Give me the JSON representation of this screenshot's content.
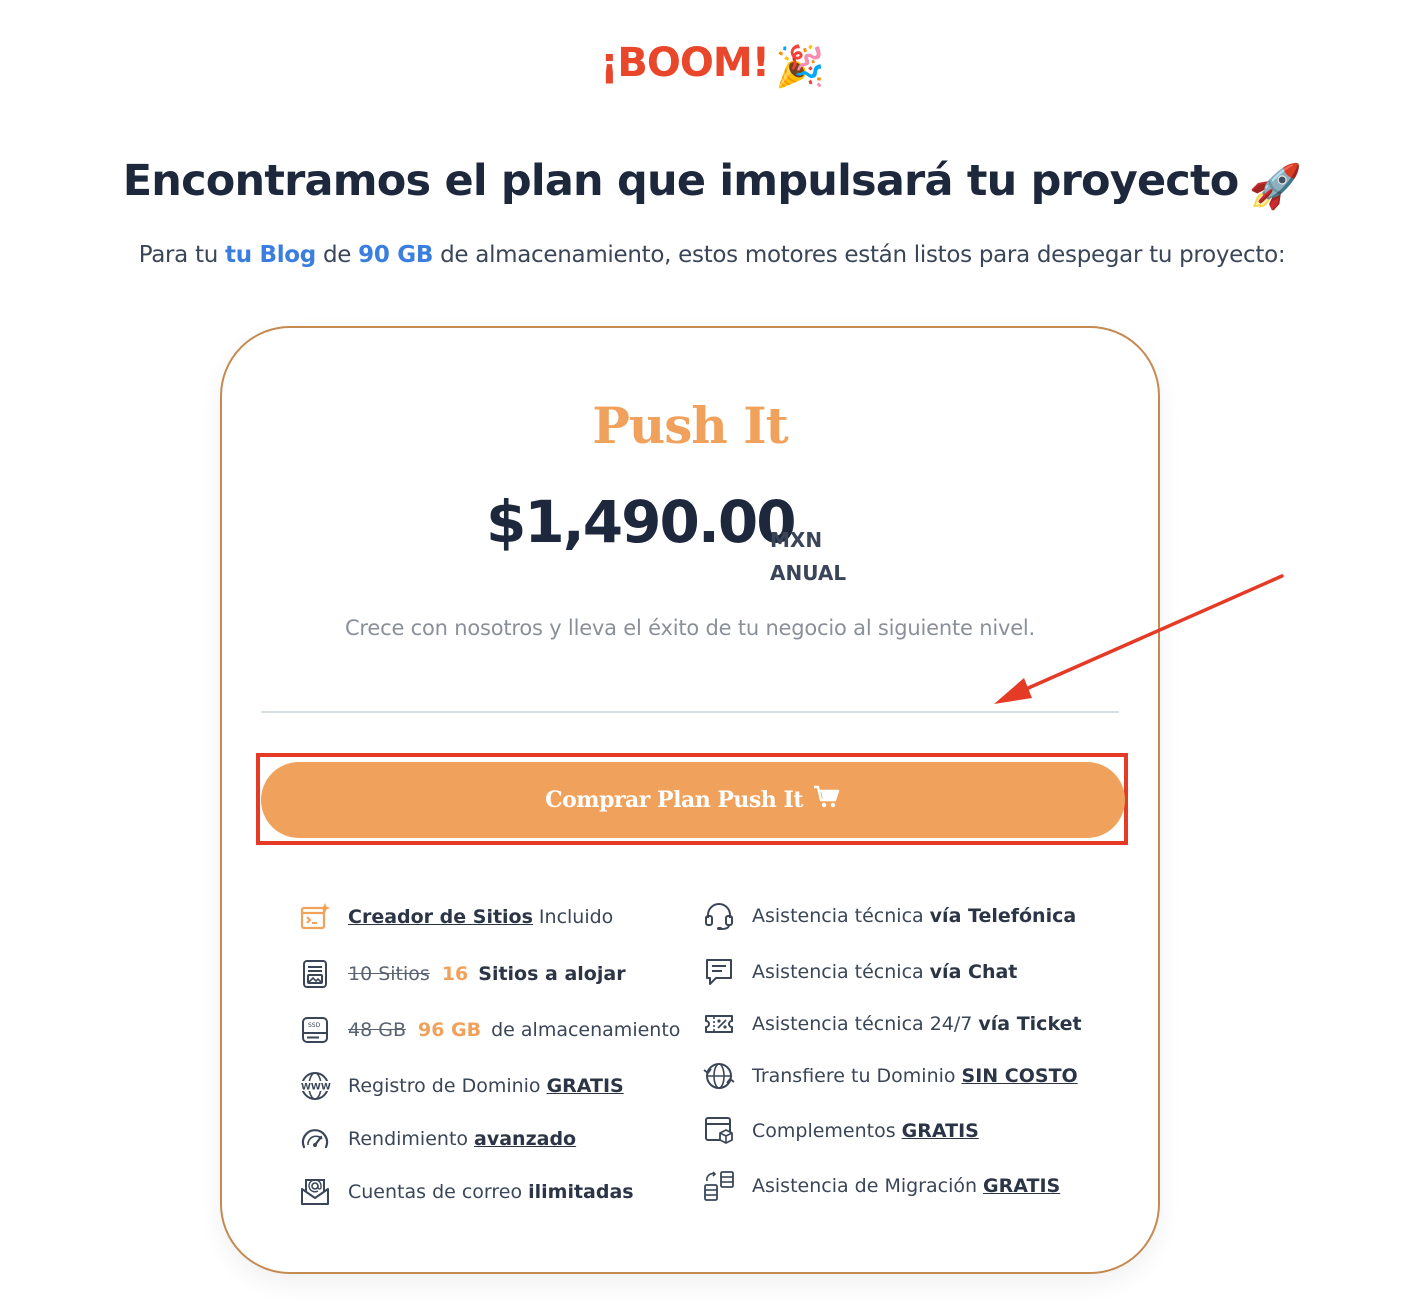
{
  "header": {
    "boom": "¡BOOM!",
    "party_emoji": "🎉",
    "headline": "Encontramos el plan que impulsará tu proyecto",
    "rocket_emoji": "🚀",
    "sub_prefix": "Para tu",
    "sub_site": "tu Blog",
    "sub_mid": "de",
    "sub_storage": "90 GB",
    "sub_suffix": "de almacenamiento, estos motores están listos para despegar tu proyecto:"
  },
  "plan": {
    "name": "Push It",
    "price": "$1,490.00",
    "currency": "MXN",
    "period": "ANUAL",
    "tagline": "Crece con nosotros y lleva el éxito de tu negocio al siguiente nivel.",
    "buy_label": "Comprar Plan Push It",
    "cart_icon": "shopping-cart-icon"
  },
  "features_left": [
    {
      "icon": "site-builder-icon",
      "link": "Creador de Sitios",
      "text": "Incluido"
    },
    {
      "icon": "sites-icon",
      "old": "10 Sitios",
      "new": "16",
      "text": "Sitios a alojar"
    },
    {
      "icon": "ssd-icon",
      "old": "48 GB",
      "new": "96 GB",
      "text": "de almacenamiento"
    },
    {
      "icon": "www-icon",
      "text": "Registro de Dominio",
      "link": "GRATIS"
    },
    {
      "icon": "speedometer-icon",
      "text": "Rendimiento",
      "link": "avanzado"
    },
    {
      "icon": "email-icon",
      "text": "Cuentas de correo",
      "bold": "ilimitadas"
    }
  ],
  "features_right": [
    {
      "icon": "headset-icon",
      "text": "Asistencia técnica",
      "bold": "vía Telefónica"
    },
    {
      "icon": "chat-icon",
      "text": "Asistencia técnica",
      "bold": "vía Chat"
    },
    {
      "icon": "ticket-icon",
      "text": "Asistencia técnica 24/7",
      "bold": "vía Ticket"
    },
    {
      "icon": "globe-transfer-icon",
      "text": "Transfiere tu Dominio",
      "link": "SIN COSTO"
    },
    {
      "icon": "addons-icon",
      "text": "Complementos",
      "link": "GRATIS"
    },
    {
      "icon": "migration-icon",
      "text": "Asistencia de Migración",
      "link": "GRATIS"
    }
  ],
  "colors": {
    "brand_orange": "#f0a25c",
    "boom_red": "#e8472c",
    "heading_navy": "#1e283c",
    "link_blue": "#3a7ee0",
    "annotation_red": "#e43a26",
    "card_border": "#c48a52"
  }
}
